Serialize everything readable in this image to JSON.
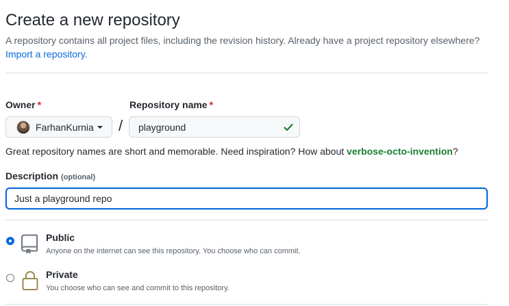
{
  "header": {
    "title": "Create a new repository",
    "subtitle": "A repository contains all project files, including the revision history. Already have a project repository elsewhere?",
    "import_link": "Import a repository."
  },
  "owner": {
    "label": "Owner",
    "required_mark": "*",
    "value": "FarhanKurnia"
  },
  "separator": "/",
  "repo_name": {
    "label": "Repository name",
    "required_mark": "*",
    "value": "playground",
    "valid": true
  },
  "hint": {
    "text": "Great repository names are short and memorable. Need inspiration? How about ",
    "suggestion": "verbose-octo-invention",
    "end": "?"
  },
  "description": {
    "label": "Description",
    "optional_label": "(optional)",
    "value": "Just a playground repo"
  },
  "visibility": {
    "options": [
      {
        "title": "Public",
        "desc": "Anyone on the internet can see this repository. You choose who can commit.",
        "icon": "repo-icon",
        "selected": true
      },
      {
        "title": "Private",
        "desc": "You choose who can see and commit to this repository.",
        "icon": "lock-icon",
        "selected": false
      }
    ]
  },
  "colors": {
    "link": "#0969da",
    "success": "#1a7f37",
    "required": "#cf222e",
    "focus": "#0969da"
  }
}
